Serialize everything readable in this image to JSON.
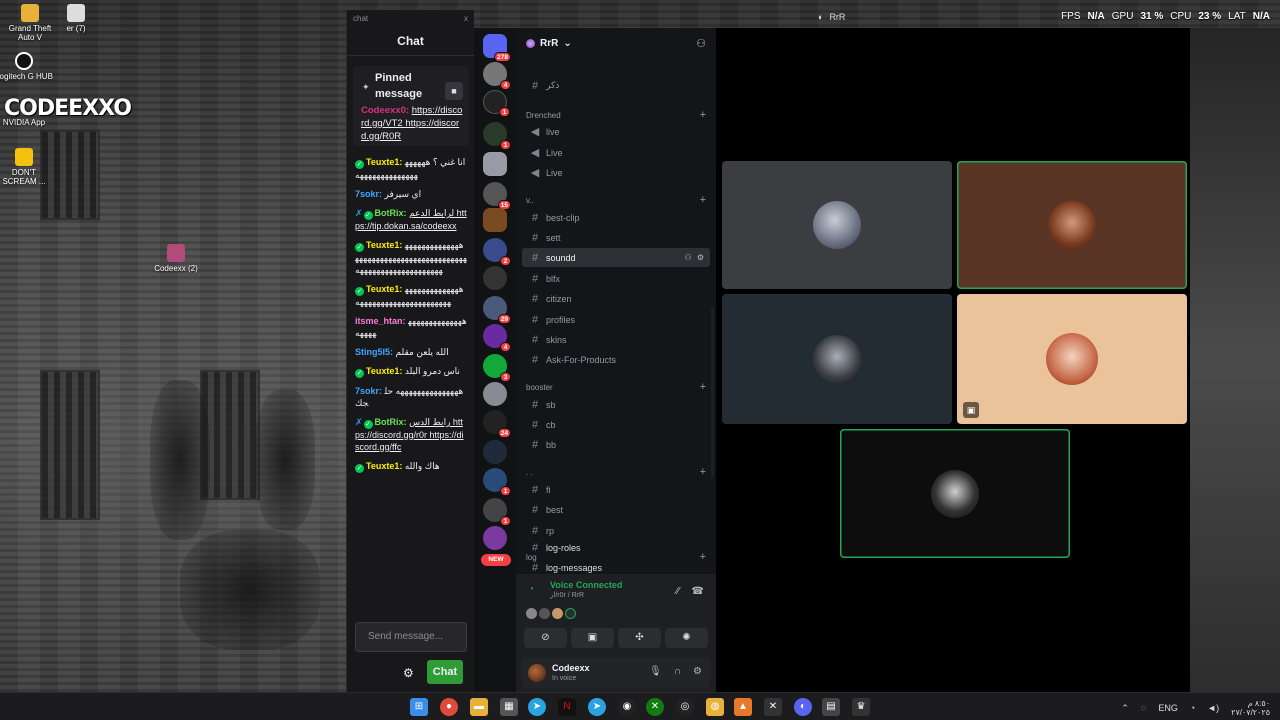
{
  "desktop": {
    "icons": [
      {
        "label": "Grand Theft Auto V"
      },
      {
        "label": "er (7)"
      },
      {
        "label": "Logitech G HUB"
      },
      {
        "label": "NVIDIA App"
      },
      {
        "label": "DON'T SCREAM ..."
      },
      {
        "label": "Codeexx (2)"
      }
    ],
    "logo_text": "CODEEXXO"
  },
  "overlay": {
    "window_title": "RrR",
    "fps_label": "FPS",
    "fps_value": "N/A",
    "gpu_label": "GPU",
    "gpu_value": "31 %",
    "cpu_label": "CPU",
    "cpu_value": "23 %",
    "lat_label": "LAT",
    "lat_value": "N/A"
  },
  "chat": {
    "window_label": "chat",
    "close": "x",
    "title": "Chat",
    "pinned_title": "Pinned message",
    "pinned_user": "Codeexx0:",
    "pinned_links": "https://discord.gg/VT2 https://discord.gg/R0R",
    "messages": [
      {
        "user": "Teuxte1:",
        "text": "انا غني ؟ ههههههههههههههههههههه"
      },
      {
        "user": "7sokr:",
        "text": "اي سيرفر"
      },
      {
        "user": "BotRix:",
        "text": "لرابط الدعم https://tip.dokan.sa/codeexx"
      },
      {
        "user": "Teuxte1:",
        "text": "هههههههههههههههههههههههههههههههههههههههههههههههههههههههههههههه"
      },
      {
        "user": "Teuxte1:",
        "text": "ههههههههههههههههههههههههههههههههههههه"
      },
      {
        "user": "itsme_htan:",
        "text": "ههههههههههههههههههه"
      },
      {
        "user": "Sting5I5:",
        "text": "الله يلعن مقلم"
      },
      {
        "user": "Teuxte1:",
        "text": "ناس دمرو البلد"
      },
      {
        "user": "7sokr:",
        "text": "هههههههههههههههه حلجك"
      },
      {
        "user": "BotRix:",
        "text": "رابط الدس https://discord.gg/r0r https://discord.gg/ffc"
      },
      {
        "user": "Teuxte1:",
        "text": "هاك والله"
      }
    ],
    "input_placeholder": "Send message...",
    "send_label": "Chat"
  },
  "discord": {
    "server_name": "RrR",
    "guild_badges": [
      "278",
      "4",
      "1",
      "1",
      "15",
      "2",
      "29",
      "4",
      "3",
      "24",
      "1",
      "1"
    ],
    "new_label": "NEW",
    "categories": [
      {
        "name": "Drenched"
      },
      {
        "name": "v.."
      },
      {
        "name": "booster"
      },
      {
        "name": ". ."
      },
      {
        "name": "log"
      }
    ],
    "channels": [
      {
        "name": "ذكر",
        "kind": "text"
      },
      {
        "name": "live",
        "kind": "voice"
      },
      {
        "name": "Live",
        "kind": "voice"
      },
      {
        "name": "Live",
        "kind": "voice"
      },
      {
        "name": "best-clip",
        "kind": "text"
      },
      {
        "name": "sett",
        "kind": "text"
      },
      {
        "name": "soundd",
        "kind": "text"
      },
      {
        "name": "blfx",
        "kind": "text"
      },
      {
        "name": "citizen",
        "kind": "text"
      },
      {
        "name": "profiles",
        "kind": "text"
      },
      {
        "name": "skins",
        "kind": "text"
      },
      {
        "name": "Ask-For-Products",
        "kind": "text"
      },
      {
        "name": "sb",
        "kind": "text"
      },
      {
        "name": "cb",
        "kind": "text"
      },
      {
        "name": "bb",
        "kind": "text"
      },
      {
        "name": "fi",
        "kind": "text"
      },
      {
        "name": "best",
        "kind": "text"
      },
      {
        "name": "rp",
        "kind": "text"
      },
      {
        "name": "log-roles",
        "kind": "text"
      },
      {
        "name": "log-messages",
        "kind": "text"
      }
    ],
    "voice": {
      "status": "Voice Connected",
      "location": "ار/r0r / RrR"
    },
    "user": {
      "name": "Codeexx",
      "status": "In voice"
    }
  },
  "taskbar": {
    "lang": "ENG",
    "time": "٨:٥٠ م",
    "date": "٢٧/٠٧/٢٠٢٥"
  }
}
